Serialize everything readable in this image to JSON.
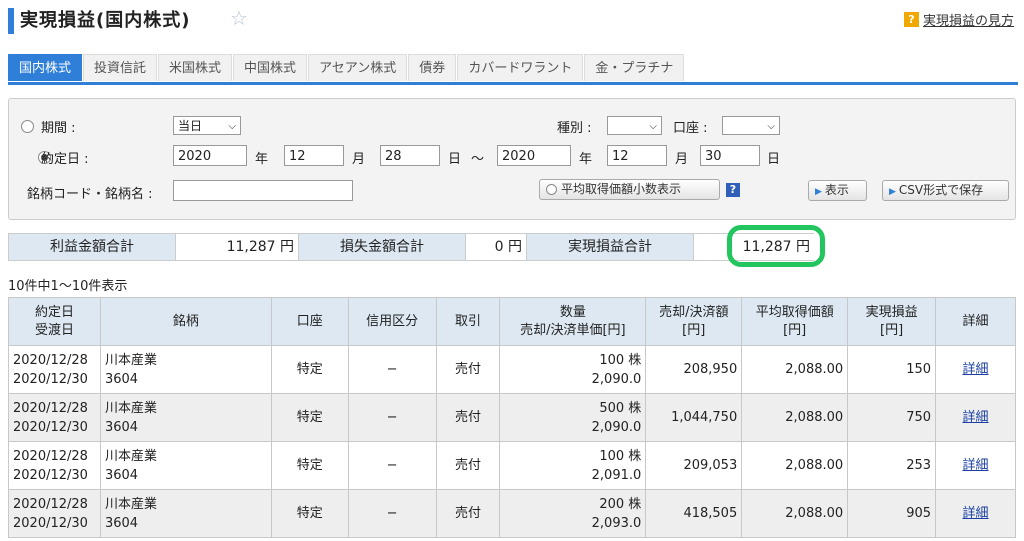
{
  "header": {
    "title": "実現損益(国内株式)",
    "help_label": "実現損益の見方",
    "help_mark": "?"
  },
  "tabs": [
    {
      "label": "国内株式",
      "active": true
    },
    {
      "label": "投資信託"
    },
    {
      "label": "米国株式"
    },
    {
      "label": "中国株式"
    },
    {
      "label": "アセアン株式"
    },
    {
      "label": "債券"
    },
    {
      "label": "カバードワラント"
    },
    {
      "label": "金・プラチナ"
    }
  ],
  "filter": {
    "period_label": "期間 :",
    "period_value": "当日",
    "trade_date_label": "約定日 :",
    "from_year": "2020",
    "from_month": "12",
    "from_day": "28",
    "to_year": "2020",
    "to_month": "12",
    "to_day": "30",
    "year_label": "年",
    "month_label": "月",
    "day_label": "日",
    "tilde": "〜",
    "type_label": "種別 :",
    "account_label": "口座 :",
    "stock_label": "銘柄コード・銘柄名 :",
    "decimal_button": "平均取得価額小数表示",
    "qmark": "?",
    "show_button": "表示",
    "csv_button": "CSV形式で保存"
  },
  "summary": {
    "profit_label": "利益金額合計",
    "profit_value": "11,287 円",
    "loss_label": "損失金額合計",
    "loss_value": "0 円",
    "realized_label": "実現損益合計",
    "realized_value": "11,287 円"
  },
  "count_text": "10件中1〜10件表示",
  "table": {
    "headers": {
      "date1": "約定日",
      "date2": "受渡日",
      "stock": "銘柄",
      "account": "口座",
      "margin": "信用区分",
      "trade": "取引",
      "qty1": "数量",
      "qty2": "売却/決済単価[円]",
      "sale1": "売却/決済額",
      "sale2": "[円]",
      "avg1": "平均取得価額",
      "avg2": "[円]",
      "pl1": "実現損益",
      "pl2": "[円]",
      "detail": "詳細"
    },
    "rows": [
      {
        "trade_date": "2020/12/28",
        "settle_date": "2020/12/30",
        "name": "川本産業",
        "code": "3604",
        "account": "特定",
        "margin": "−",
        "trade": "売付",
        "qty": "100 株",
        "price": "2,090.0",
        "amount": "208,950",
        "avg": "2,088.00",
        "pl": "150",
        "detail": "詳細"
      },
      {
        "trade_date": "2020/12/28",
        "settle_date": "2020/12/30",
        "name": "川本産業",
        "code": "3604",
        "account": "特定",
        "margin": "−",
        "trade": "売付",
        "qty": "500 株",
        "price": "2,090.0",
        "amount": "1,044,750",
        "avg": "2,088.00",
        "pl": "750",
        "detail": "詳細"
      },
      {
        "trade_date": "2020/12/28",
        "settle_date": "2020/12/30",
        "name": "川本産業",
        "code": "3604",
        "account": "特定",
        "margin": "−",
        "trade": "売付",
        "qty": "100 株",
        "price": "2,091.0",
        "amount": "209,053",
        "avg": "2,088.00",
        "pl": "253",
        "detail": "詳細"
      },
      {
        "trade_date": "2020/12/28",
        "settle_date": "2020/12/30",
        "name": "川本産業",
        "code": "3604",
        "account": "特定",
        "margin": "−",
        "trade": "売付",
        "qty": "200 株",
        "price": "2,093.0",
        "amount": "418,505",
        "avg": "2,088.00",
        "pl": "905",
        "detail": "詳細"
      }
    ]
  },
  "colors": {
    "accent": "#2f7ed8",
    "highlight": "#22c55e",
    "header_bg": "#dde8f3",
    "link": "#1a3fa3"
  }
}
